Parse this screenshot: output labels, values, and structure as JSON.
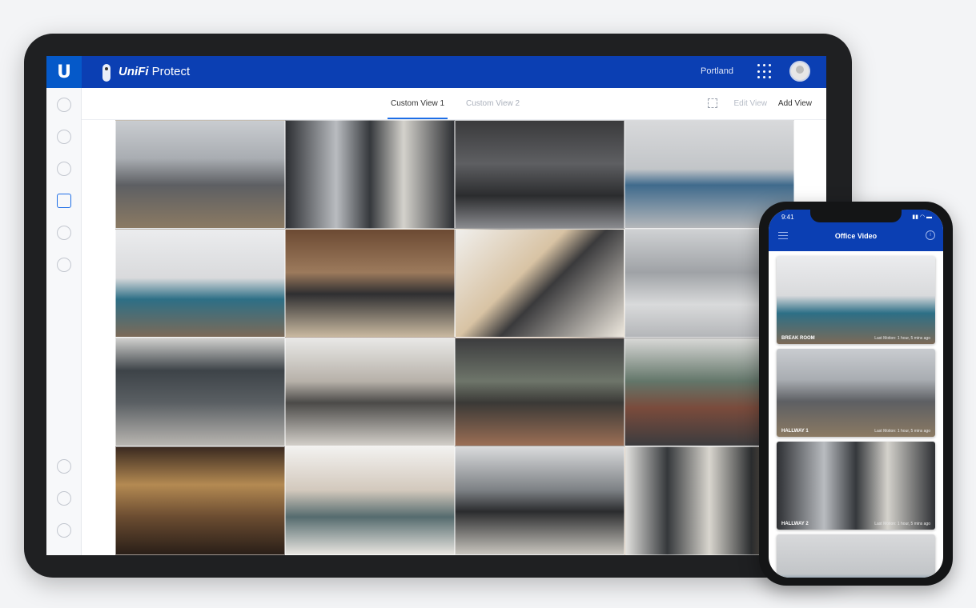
{
  "app": {
    "logo_letter": "U",
    "brand": "UniFi",
    "product": "Protect",
    "location": "Portland"
  },
  "tabs": [
    {
      "label": "Custom View 1",
      "active": true
    },
    {
      "label": "Custom View 2",
      "active": false
    }
  ],
  "toolbar": {
    "edit_label": "Edit View",
    "add_label": "Add View"
  },
  "sidebar": {
    "icons": [
      "dashboard-icon",
      "devices-icon",
      "map-icon",
      "video-icon",
      "play-icon",
      "health-icon",
      "notifications-icon",
      "chat-icon",
      "settings-icon"
    ]
  },
  "camera_grid": {
    "rows": 4,
    "cols": 4,
    "cells": [
      {
        "scene": "hallway-glass"
      },
      {
        "scene": "corridor-steel"
      },
      {
        "scene": "open-office"
      },
      {
        "scene": "empty-room"
      },
      {
        "scene": "lounge"
      },
      {
        "scene": "desk-workspace"
      },
      {
        "scene": "staircase"
      },
      {
        "scene": "office-floor"
      },
      {
        "scene": "elevator-lobby"
      },
      {
        "scene": "meeting-glass"
      },
      {
        "scene": "cafe-dining"
      },
      {
        "scene": "conference-room"
      },
      {
        "scene": "bookshelf"
      },
      {
        "scene": "living-area"
      },
      {
        "scene": "workstations"
      },
      {
        "scene": "column-hall"
      }
    ]
  },
  "phone": {
    "time": "9:41",
    "title": "Office Video",
    "feeds": [
      {
        "label": "BREAK ROOM",
        "meta": "Last Motion: 1 hour, 5 mins ago"
      },
      {
        "label": "HALLWAY 1",
        "meta": "Last Motion: 1 hour, 5 mins ago"
      },
      {
        "label": "HALLWAY 2",
        "meta": "Last Motion: 1 hour, 5 mins ago"
      },
      {
        "label": "",
        "meta": ""
      }
    ]
  },
  "colors": {
    "topbar": "#0b3fb3",
    "accent": "#1e6ee6"
  }
}
